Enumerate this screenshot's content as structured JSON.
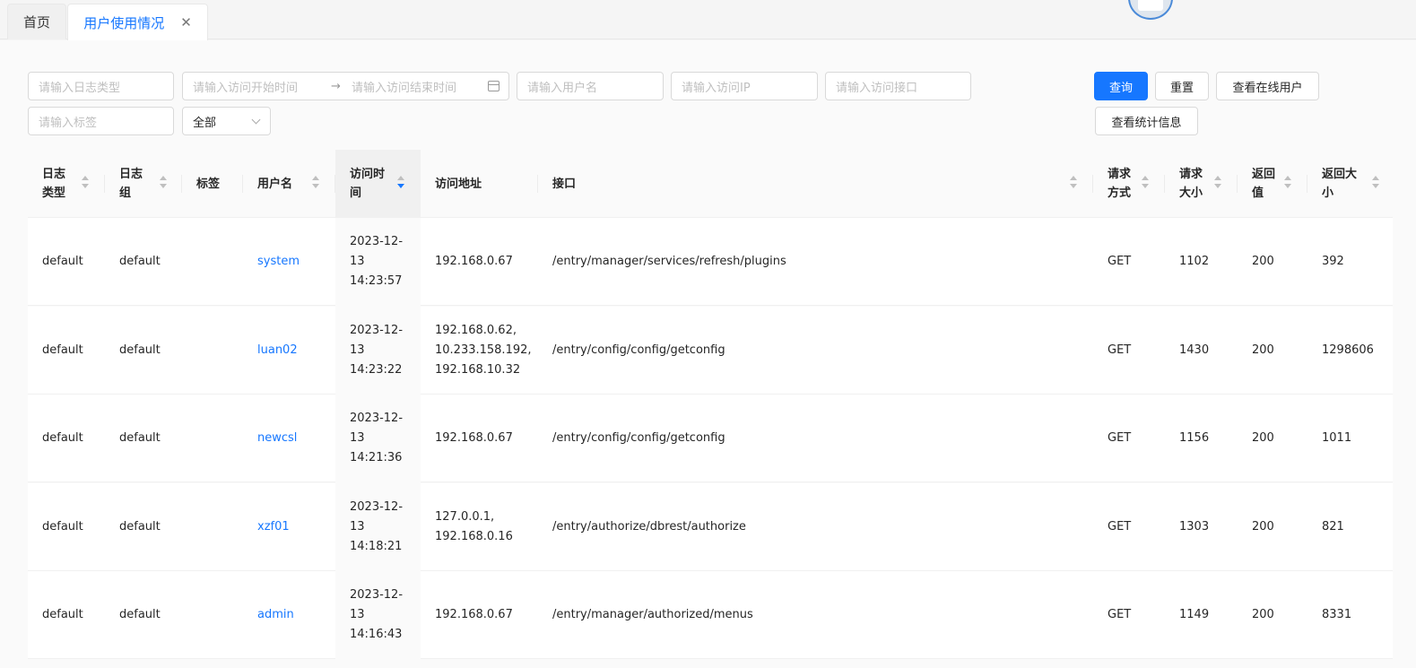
{
  "tabs": [
    {
      "label": "首页"
    },
    {
      "label": "用户使用情况"
    }
  ],
  "filters": {
    "log_type_placeholder": "请输入日志类型",
    "start_time_placeholder": "请输入访问开始时间",
    "end_time_placeholder": "请输入访问结束时间",
    "username_placeholder": "请输入用户名",
    "ip_placeholder": "请输入访问IP",
    "api_placeholder": "请输入访问接口",
    "tag_placeholder": "请输入标签",
    "select_value": "全部"
  },
  "buttons": {
    "query": "查询",
    "reset": "重置",
    "online_users": "查看在线用户",
    "stats": "查看统计信息"
  },
  "columns": [
    {
      "label": "日志\n类型"
    },
    {
      "label": "日志\n组"
    },
    {
      "label": "标签"
    },
    {
      "label": "用户名"
    },
    {
      "label": "访问时\n间"
    },
    {
      "label": "访问地址"
    },
    {
      "label": "接口"
    },
    {
      "label": "请求\n方式"
    },
    {
      "label": "请求\n大小"
    },
    {
      "label": "返回\n值"
    },
    {
      "label": "返回大\n小"
    }
  ],
  "sorted_column": "访问时间",
  "rows": [
    {
      "log_type": "default",
      "log_group": "default",
      "tag": "",
      "username": "system",
      "time": "2023-12-\n13\n14:23:57",
      "ip": "192.168.0.67",
      "api": "/entry/manager/services/refresh/plugins",
      "method": "GET",
      "req_size": "1102",
      "status": "200",
      "resp_size": "392"
    },
    {
      "log_type": "default",
      "log_group": "default",
      "tag": "",
      "username": "luan02",
      "time": "2023-12-\n13\n14:23:22",
      "ip": "192.168.0.62,\n10.233.158.192,\n192.168.10.32",
      "api": "/entry/config/config/getconfig",
      "method": "GET",
      "req_size": "1430",
      "status": "200",
      "resp_size": "1298606"
    },
    {
      "log_type": "default",
      "log_group": "default",
      "tag": "",
      "username": "newcsl",
      "time": "2023-12-\n13\n14:21:36",
      "ip": "192.168.0.67",
      "api": "/entry/config/config/getconfig",
      "method": "GET",
      "req_size": "1156",
      "status": "200",
      "resp_size": "1011"
    },
    {
      "log_type": "default",
      "log_group": "default",
      "tag": "",
      "username": "xzf01",
      "time": "2023-12-\n13\n14:18:21",
      "ip": "127.0.0.1,\n192.168.0.16",
      "api": "/entry/authorize/dbrest/authorize",
      "method": "GET",
      "req_size": "1303",
      "status": "200",
      "resp_size": "821"
    },
    {
      "log_type": "default",
      "log_group": "default",
      "tag": "",
      "username": "admin",
      "time": "2023-12-\n13\n14:16:43",
      "ip": "192.168.0.67",
      "api": "/entry/manager/authorized/menus",
      "method": "GET",
      "req_size": "1149",
      "status": "200",
      "resp_size": "8331"
    }
  ],
  "colors": {
    "primary": "#1677ff",
    "link": "#1677ff"
  }
}
